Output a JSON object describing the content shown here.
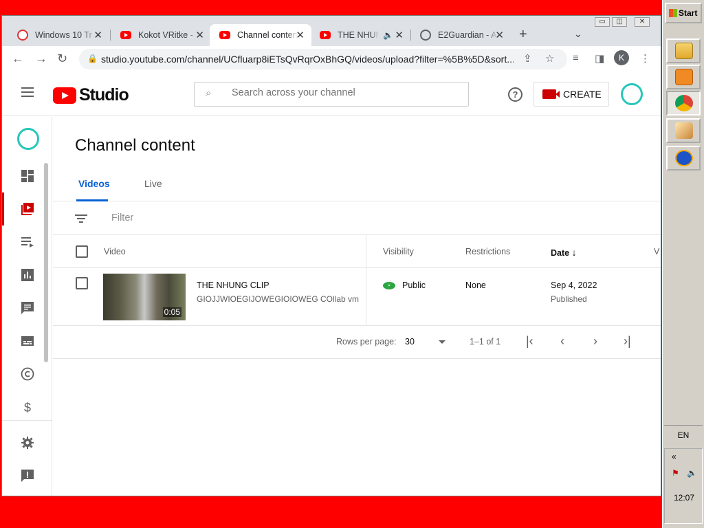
{
  "browser": {
    "tabs": [
      {
        "title": "Windows 10 Tr",
        "favicon": "windows10-favicon"
      },
      {
        "title": "Kokot VRitke -",
        "favicon": "youtube-favicon"
      },
      {
        "title": "Channel conten",
        "favicon": "youtube-favicon",
        "active": true
      },
      {
        "title": "THE NHUN",
        "favicon": "youtube-favicon",
        "audio": true
      },
      {
        "title": "E2Guardian - A",
        "favicon": "globe-favicon"
      }
    ],
    "url": "studio.youtube.com/channel/UCfluarp8iETsQvRqrOxBhGQ/videos/upload?filter=%5B%5D&sort...",
    "profile_initial": "K",
    "window_controls": {
      "minimize": "▭",
      "restore": "◫",
      "close": "✕"
    }
  },
  "header": {
    "logo_text": "Studio",
    "search_placeholder": "Search across your channel",
    "create_label": "CREATE",
    "help_icon": "?"
  },
  "main": {
    "title": "Channel content",
    "tabs": [
      {
        "label": "Videos",
        "active": true
      },
      {
        "label": "Live",
        "active": false
      }
    ],
    "filter_placeholder": "Filter",
    "columns": {
      "video": "Video",
      "visibility": "Visibility",
      "restrictions": "Restrictions",
      "date": "Date",
      "views_partial": "V"
    },
    "rows": [
      {
        "title": "THE NHUNG CLIP",
        "description": "GIOJJWIOEGIJOWEGIOIOWEG COllab vm",
        "duration": "0:05",
        "visibility": "Public",
        "restrictions": "None",
        "date": "Sep 4, 2022",
        "date_status": "Published"
      }
    ],
    "pagination": {
      "rows_per_page_label": "Rows per page:",
      "rows_per_page": "30",
      "range": "1–1 of 1"
    }
  },
  "taskbar": {
    "start_label": "Start",
    "language": "EN",
    "clock": "12:07",
    "tray_chevron": "«"
  },
  "colors": {
    "desktop": "#ff0000",
    "accent_red": "#ff0000",
    "tab_active_blue": "#065fd4",
    "avatar_ring": "#27c7b9",
    "public_green": "#2ba640"
  }
}
